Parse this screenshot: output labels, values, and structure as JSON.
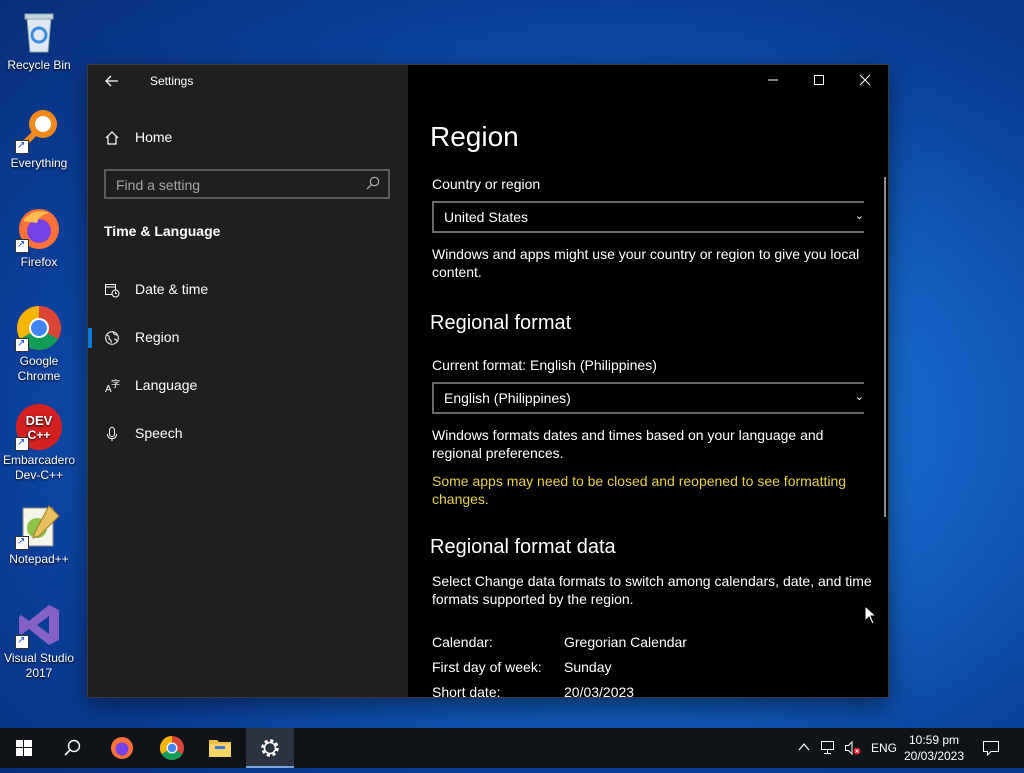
{
  "desktop": {
    "icons": [
      {
        "label": "Recycle Bin"
      },
      {
        "label": "Everything"
      },
      {
        "label": "Firefox"
      },
      {
        "label": "Google Chrome"
      },
      {
        "label": "Embarcadero Dev-C++"
      },
      {
        "label": "Notepad++"
      },
      {
        "label": "Visual Studio 2017"
      }
    ]
  },
  "window": {
    "app_title": "Settings",
    "nav": {
      "home": "Home",
      "search_placeholder": "Find a setting",
      "section": "Time & Language",
      "items": [
        {
          "label": "Date & time",
          "icon": "calendar-clock-icon"
        },
        {
          "label": "Region",
          "icon": "globe-icon",
          "active": true
        },
        {
          "label": "Language",
          "icon": "language-icon"
        },
        {
          "label": "Speech",
          "icon": "microphone-icon"
        }
      ]
    },
    "content": {
      "title": "Region",
      "country_label": "Country or region",
      "country_value": "United States",
      "country_help": "Windows and apps might use your country or region to give you local content.",
      "regional_format_title": "Regional format",
      "current_format_label": "Current format: English (Philippines)",
      "format_value": "English (Philippines)",
      "format_help": "Windows formats dates and times based on your language and regional preferences.",
      "format_warning": "Some apps may need to be closed and reopened to see formatting changes.",
      "format_data_title": "Regional format data",
      "format_data_help": "Select Change data formats to switch among calendars, date, and time formats supported by the region.",
      "format_data": [
        {
          "key": "Calendar:",
          "value": "Gregorian Calendar"
        },
        {
          "key": "First day of week:",
          "value": "Sunday"
        },
        {
          "key": "Short date:",
          "value": "20/03/2023"
        }
      ]
    }
  },
  "taskbar": {
    "language": "ENG",
    "time": "10:59 pm",
    "date": "20/03/2023"
  },
  "colors": {
    "accent": "#0078d7",
    "warning_text": "#e6d04a",
    "nav_bg": "#1f1f1f",
    "content_bg": "#000000"
  }
}
